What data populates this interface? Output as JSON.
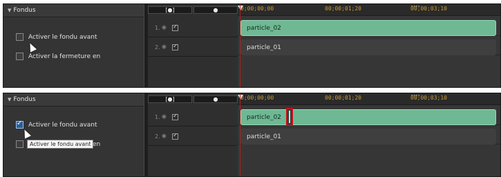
{
  "section": {
    "title": "Fondus"
  },
  "options": {
    "fade_in_label": "Activer le fondu avant",
    "fade_out_label": "Activer la fermeture en"
  },
  "tooltip": {
    "text": "Activer le fondu avant"
  },
  "state": {
    "top": {
      "fade_in_checked": false
    },
    "bottom": {
      "fade_in_checked": true
    }
  },
  "track_header": {
    "tab_left_icon": "[●]",
    "tab_right_icon": "●"
  },
  "tracks": [
    {
      "index": "1.",
      "clip": "particle_02"
    },
    {
      "index": "2.",
      "clip": "particle_01"
    }
  ],
  "ruler": {
    "tc0": "0;00;00;00",
    "tc1": "00;00;01;20",
    "tc2": "00;00;03;10"
  },
  "colors": {
    "clip_selected": "#6fb894",
    "playhead": "#b02020",
    "highlight_box": "#c0141a"
  },
  "icons": [
    "triangle-down-icon",
    "bulb-icon",
    "checkbox-icon",
    "playhead-marker-icon",
    "mouse-cursor-icon"
  ]
}
